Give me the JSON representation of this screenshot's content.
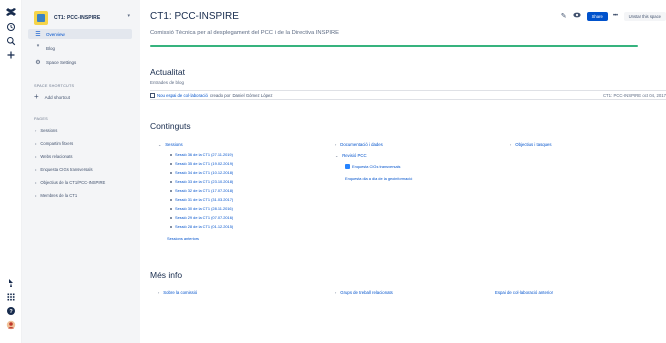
{
  "rail": {
    "icons": [
      "confluence-logo-icon",
      "history-icon",
      "search-icon",
      "create-icon"
    ],
    "bottom_icons": [
      "notifications-icon",
      "app-switcher-icon",
      "help-icon",
      "profile-avatar-icon"
    ]
  },
  "sidebar": {
    "space_name": "CT1: PCC-INSPIRE",
    "nav": [
      {
        "label": "Overview",
        "active": true
      },
      {
        "label": "Blog",
        "active": false
      },
      {
        "label": "Space Settings",
        "active": false
      }
    ],
    "shortcuts_heading": "SPACE SHORTCUTS",
    "add_shortcut": "Add shortcut",
    "pages_heading": "PAGES",
    "pages": [
      "Sessions",
      "Compartim fitxers",
      "Webs relacionats",
      "Enquesta CIGs transversals",
      "Objectius de la CT1/PCC-INSPIRE",
      "Membres de la CT1"
    ]
  },
  "header": {
    "title": "CT1: PCC-INSPIRE",
    "subtitle": "Comissió Tècnica per al desplegament del PCC i de la Directiva INSPIRE",
    "share": "Share",
    "more": "•••",
    "unstar": "Unstar this space"
  },
  "actualitat": {
    "heading": "Actualitat",
    "subheading": "Entrades de blog",
    "post_title": "Nou espai de col·laboració",
    "post_by": "creado por",
    "post_author": "Daniel Gómez López",
    "post_meta": "CT1: PCC-INSPIRE  oct 04, 2017"
  },
  "continguts": {
    "heading": "Continguts",
    "col1_head": "Sessions",
    "sessions": [
      "Sessió 36 de la CT1 (27.11.2019)",
      "Sessió 35 de la CT1 (19.02.2019)",
      "Sessió 34 de la CT1 (10.12.2018)",
      "Sessió 33 de la CT1 (23.10.2018)",
      "Sessió 32 de la CT1 (17.07.2018)",
      "Sessió 31 de la CT1 (31.03.2017)",
      "Sessió 30 de la CT1 (28.11.2016)",
      "Sessió 29 de la CT1 (07.07.2016)",
      "Sessió 28 de la CT1 (01.12.2015)"
    ],
    "sessions_more": "Sessions anteriors",
    "col2_head": "Documentació i dades",
    "col2_head2": "Revisió PCC",
    "col2_items": [
      "Enquesta CIGs transversals",
      "Enquesta dia a dia de la geoinformació"
    ],
    "col3_head": "Objectius i tasques"
  },
  "mesinfo": {
    "heading": "Més info",
    "link1": "Sobre la comissió",
    "link2": "Grups de treball relacionats",
    "link3": "Espai de col·laboració anterior"
  }
}
